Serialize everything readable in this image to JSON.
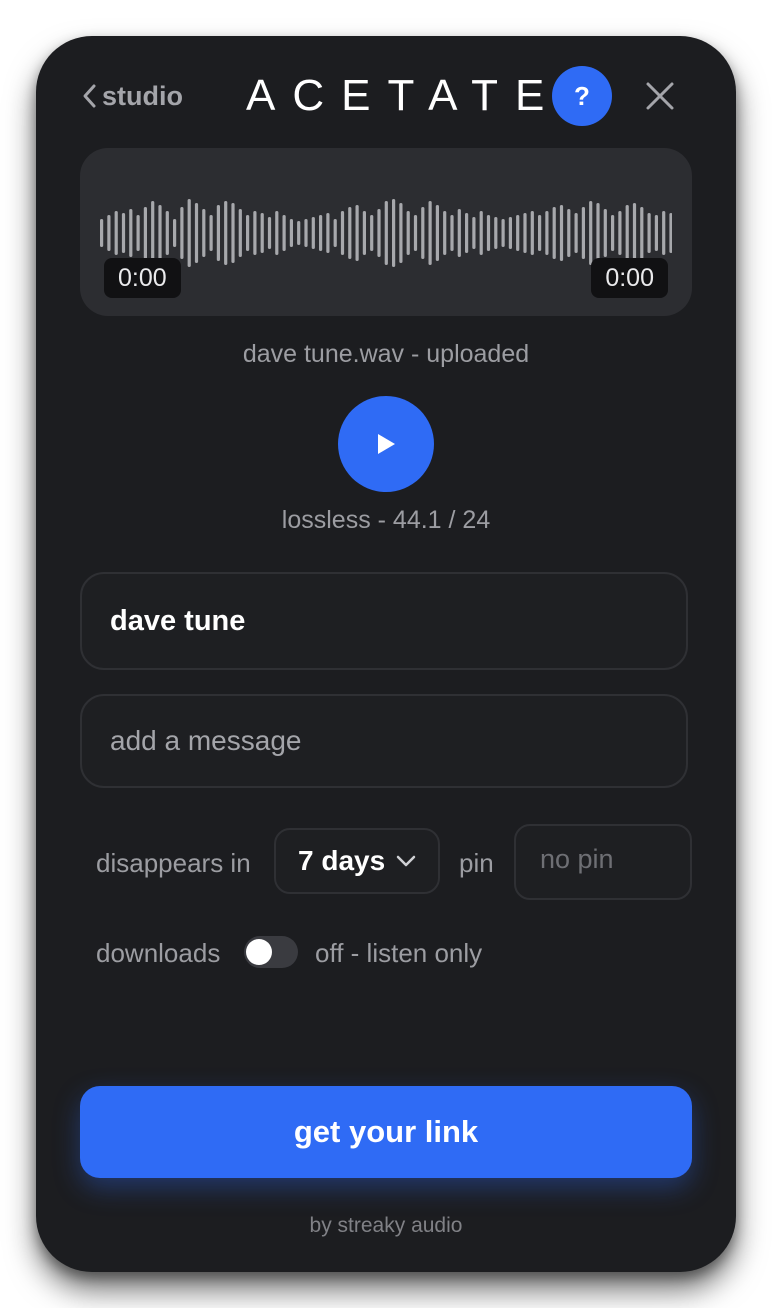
{
  "header": {
    "back_label": "studio",
    "brand": "ACETATE",
    "help_label": "?"
  },
  "player": {
    "time_start": "0:00",
    "time_end": "0:00",
    "file_status": "dave tune.wav - uploaded",
    "quality": "lossless - 44.1 / 24"
  },
  "form": {
    "title_value": "dave tune",
    "message_placeholder": "add a message",
    "expiry_label": "disappears in",
    "expiry_value": "7 days",
    "pin_label": "pin",
    "pin_placeholder": "no pin",
    "downloads_label": "downloads",
    "downloads_state": "off - listen only"
  },
  "actions": {
    "submit_label": "get your link"
  },
  "footer": {
    "credit": "by streaky audio"
  },
  "colors": {
    "accent": "#2f6bf5",
    "panel": "#1c1d20"
  }
}
